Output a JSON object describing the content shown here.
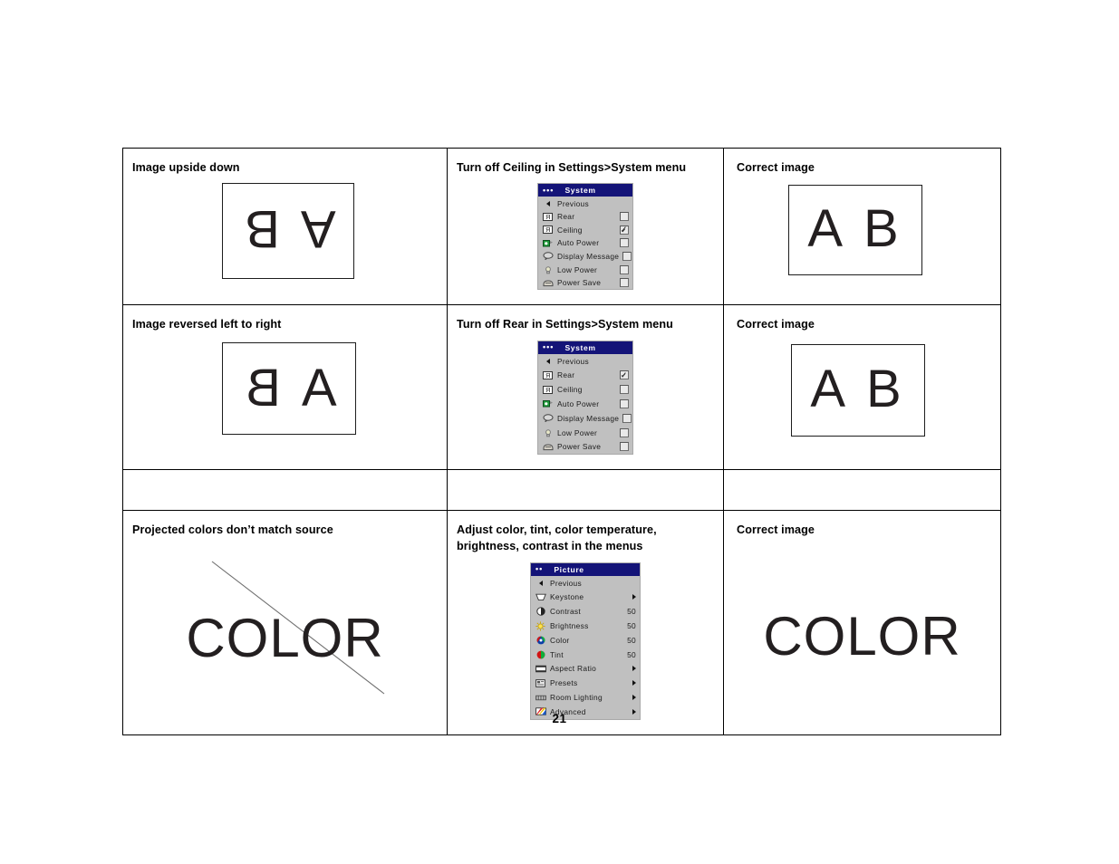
{
  "page": {
    "number": "21"
  },
  "table": {
    "rows": [
      {
        "problem": "Image upside down",
        "solution": "Turn off Ceiling in Settings>System menu",
        "result": "Correct image",
        "problem_image_text": "A B",
        "result_image_text": "A B"
      },
      {
        "problem": "Image reversed left to right",
        "solution": "Turn off Rear in Settings>System menu",
        "result": "Correct image",
        "problem_image_text": "A B",
        "result_image_text": "A B"
      },
      {
        "problem": "",
        "solution": "",
        "result": ""
      },
      {
        "problem": "Projected colors don’t match source",
        "solution": "Adjust color, tint, color temperature,\nbrightness, contrast in the menus",
        "result": "Correct image",
        "problem_image_text": "COLOR",
        "result_image_text": "COLOR"
      }
    ]
  },
  "osd_system_ceiling": {
    "title": "System",
    "items": [
      {
        "label": "Previous",
        "icon": "back-arrow-icon",
        "control": "none"
      },
      {
        "label": "Rear",
        "icon": "rear-projection-icon",
        "control": "checkbox",
        "checked": false
      },
      {
        "label": "Ceiling",
        "icon": "ceiling-projection-icon",
        "control": "checkbox",
        "checked": true
      },
      {
        "label": "Auto Power",
        "icon": "auto-power-icon",
        "control": "checkbox",
        "checked": false
      },
      {
        "label": "Display Message",
        "icon": "display-message-icon",
        "control": "checkbox",
        "checked": false
      },
      {
        "label": "Low Power",
        "icon": "low-power-icon",
        "control": "checkbox",
        "checked": false
      },
      {
        "label": "Power Save",
        "icon": "power-save-icon",
        "control": "checkbox",
        "checked": false
      }
    ]
  },
  "osd_system_rear": {
    "title": "System",
    "items": [
      {
        "label": "Previous",
        "icon": "back-arrow-icon",
        "control": "none"
      },
      {
        "label": "Rear",
        "icon": "rear-projection-icon",
        "control": "checkbox",
        "checked": true
      },
      {
        "label": "Ceiling",
        "icon": "ceiling-projection-icon",
        "control": "checkbox",
        "checked": false
      },
      {
        "label": "Auto Power",
        "icon": "auto-power-icon",
        "control": "checkbox",
        "checked": false
      },
      {
        "label": "Display Message",
        "icon": "display-message-icon",
        "control": "checkbox",
        "checked": false
      },
      {
        "label": "Low Power",
        "icon": "low-power-icon",
        "control": "checkbox",
        "checked": false
      },
      {
        "label": "Power Save",
        "icon": "power-save-icon",
        "control": "checkbox",
        "checked": false
      }
    ]
  },
  "osd_picture": {
    "title": "Picture",
    "items": [
      {
        "label": "Previous",
        "icon": "back-arrow-icon",
        "control": "none"
      },
      {
        "label": "Keystone",
        "icon": "keystone-icon",
        "control": "submenu"
      },
      {
        "label": "Contrast",
        "icon": "contrast-icon",
        "control": "value",
        "value": "50"
      },
      {
        "label": "Brightness",
        "icon": "brightness-icon",
        "control": "value",
        "value": "50"
      },
      {
        "label": "Color",
        "icon": "color-icon",
        "control": "value",
        "value": "50"
      },
      {
        "label": "Tint",
        "icon": "tint-icon",
        "control": "value",
        "value": "50"
      },
      {
        "label": "Aspect Ratio",
        "icon": "aspect-ratio-icon",
        "control": "submenu"
      },
      {
        "label": "Presets",
        "icon": "presets-icon",
        "control": "submenu"
      },
      {
        "label": "Room Lighting",
        "icon": "room-lighting-icon",
        "control": "submenu"
      },
      {
        "label": "Advanced",
        "icon": "advanced-icon",
        "control": "submenu"
      }
    ]
  },
  "colors": {
    "menu_title_bar": "#141478",
    "menu_background": "#c0c0c0",
    "text": "#231f20"
  }
}
